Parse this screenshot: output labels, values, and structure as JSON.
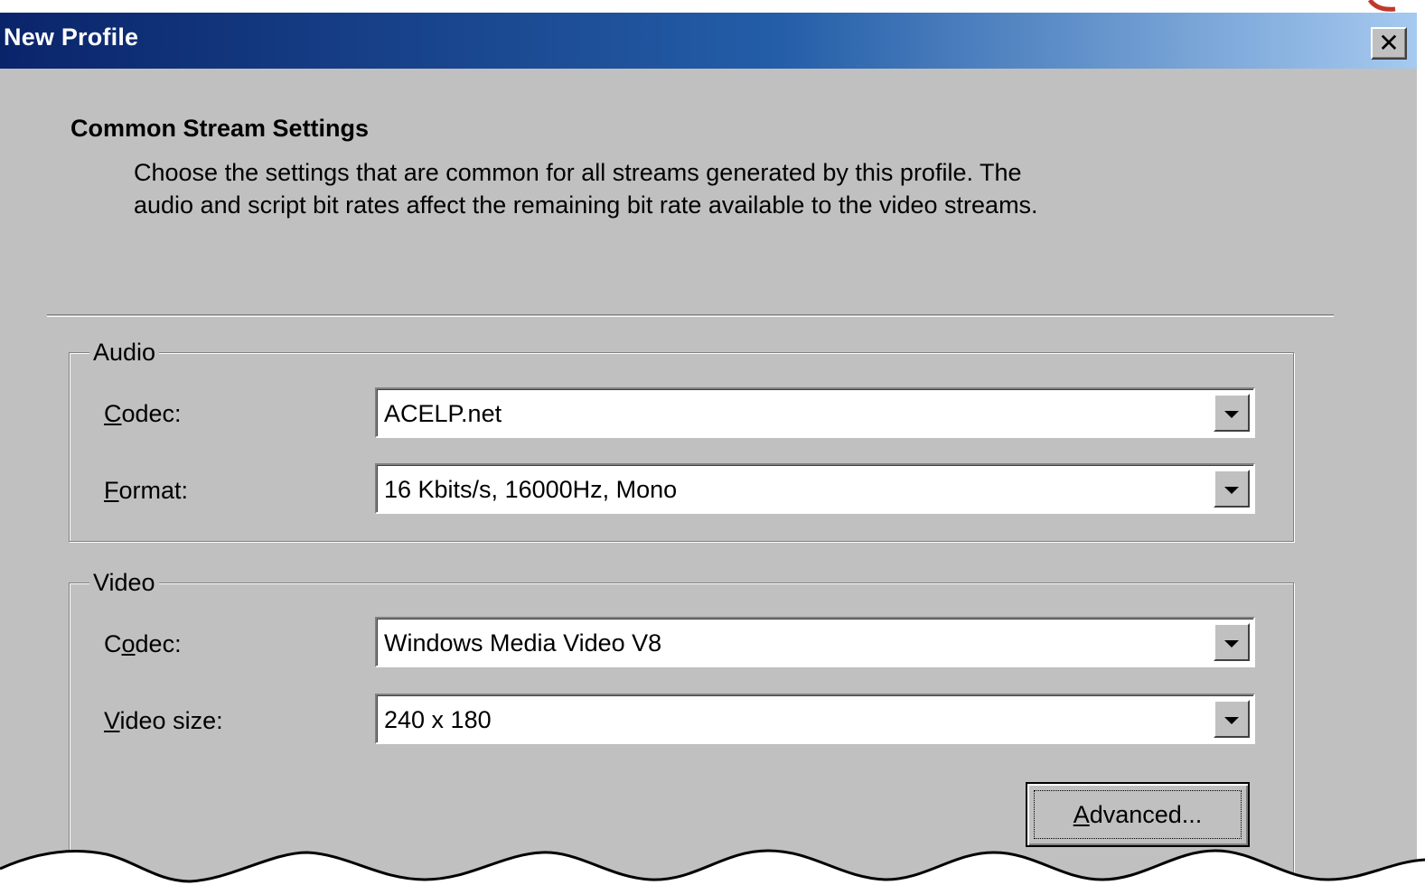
{
  "window": {
    "title": "New Profile",
    "close_glyph": "✕"
  },
  "header": {
    "heading": "Common Stream Settings",
    "description": "Choose the settings that are common for all streams generated by this profile. The\naudio and script bit rates affect the remaining bit rate available to the video streams."
  },
  "audio": {
    "legend": "Audio",
    "codec": {
      "label_mnemonic": "C",
      "label_rest": "odec:",
      "value": "ACELP.net"
    },
    "format": {
      "label_mnemonic": "F",
      "label_rest": "ormat:",
      "value": "16 Kbits/s, 16000Hz, Mono"
    }
  },
  "video": {
    "legend": "Video",
    "codec": {
      "label_pre": "C",
      "label_mnemonic": "o",
      "label_rest": "dec:",
      "value": "Windows Media Video V8"
    },
    "size": {
      "label_mnemonic": "V",
      "label_rest": "ideo size:",
      "value": "240 x 180"
    },
    "advanced": {
      "label_mnemonic": "A",
      "label_rest": "dvanced..."
    }
  },
  "icons": {
    "dropdown": "chevron-down-icon",
    "close": "close-icon"
  },
  "colors": {
    "title_bar_start": "#0a246a",
    "title_bar_end": "#a6caf0",
    "face": "#c0c0c0",
    "corner_accent": "#c0392b"
  }
}
